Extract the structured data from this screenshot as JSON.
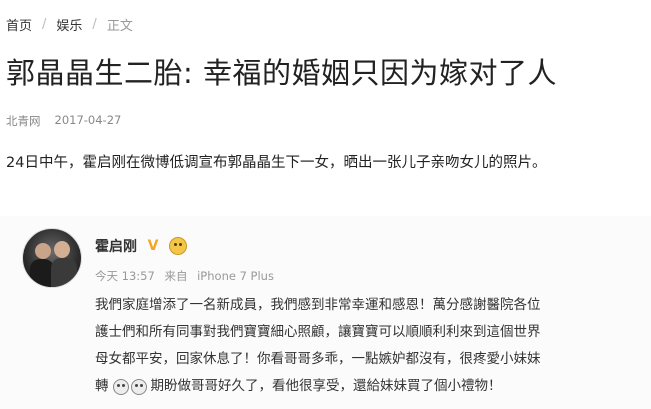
{
  "breadcrumb": {
    "items": [
      "首页",
      "娱乐",
      "正文"
    ],
    "separator": "/"
  },
  "article": {
    "title": "郭晶晶生二胎: 幸福的婚姻只因为嫁对了人",
    "source": "北青网",
    "date": "2017-04-27",
    "paragraph": "24日中午，霍启刚在微博低调宣布郭晶晶生下一女，晒出一张儿子亲吻女儿的照片。"
  },
  "weibo_post": {
    "username": "霍启刚",
    "badge": "V",
    "meta": {
      "time": "今天 13:57",
      "from": "来自",
      "device": "iPhone 7 Plus"
    },
    "lines": [
      "我們家庭增添了一名新成員，我們感到非常幸運和感恩！萬分感謝醫院各位",
      "護士們和所有同事對我們寶寶細心照顧，讓寶寶可以順順利利來到這個世界",
      "母女都平安，回家休息了！你看哥哥多乖，一點嫉妒都沒有，很疼愛小妹妹",
      "期盼做哥哥好久了，看他很享受，還給妹妹買了個小禮物！"
    ],
    "line4_prefix": "轉",
    "icons": {
      "avatar": "avatar-photo",
      "badge": "verified-badge-icon",
      "emoji": "smile-emoji-icon"
    }
  },
  "colors": {
    "accent_badge": "#f5a623",
    "text": "#222222",
    "muted": "#888888"
  }
}
